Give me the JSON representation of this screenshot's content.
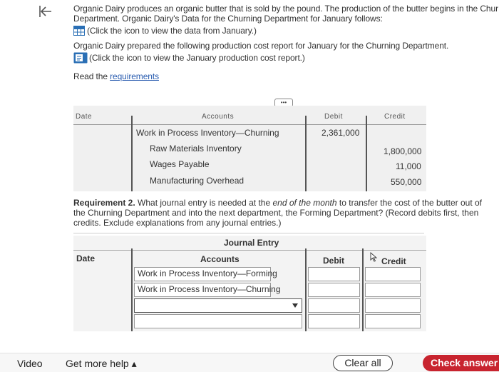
{
  "intro": {
    "line1": "Organic Dairy produces an organic butter that is sold by the pound. The production of the butter begins in the Chur",
    "line2": "Department. Organic Dairy's Data for the Churning Department for January follows:",
    "data_link": "(Click the icon to view the data from January.)",
    "line4": "Organic Dairy prepared the following production cost report for January for the Churning Department.",
    "report_link": "(Click the icon to view the January production cost report.)",
    "read_prefix": "Read the ",
    "requirements_link": "requirements"
  },
  "table1": {
    "headers": {
      "date": "Date",
      "accounts": "Accounts",
      "debit": "Debit",
      "credit": "Credit"
    },
    "more_button": "•••",
    "rows": [
      {
        "account": "Work in Process Inventory—Churning",
        "debit": "2,361,000",
        "credit": ""
      },
      {
        "account": "Raw Materials Inventory",
        "debit": "",
        "credit": "1,800,000"
      },
      {
        "account": "Wages Payable",
        "debit": "",
        "credit": "11,000"
      },
      {
        "account": "Manufacturing Overhead",
        "debit": "",
        "credit": "550,000"
      }
    ]
  },
  "requirement2": {
    "label": "Requirement 2.",
    "text_a": " What journal entry is needed at the ",
    "emph": "end of the month",
    "text_b": " to transfer the cost of the butter out of the Churning Department and into the next department, the Forming Department? (Record debits first, then credits. Exclude explanations from any journal entries.)"
  },
  "journal": {
    "title": "Journal Entry",
    "headers": {
      "date": "Date",
      "accounts": "Accounts",
      "debit": "Debit",
      "credit": "Credit"
    },
    "rows": [
      {
        "account": "Work in Process Inventory—Forming"
      },
      {
        "account": "Work in Process Inventory—Churning"
      },
      {
        "account": ""
      },
      {
        "account": ""
      }
    ]
  },
  "footer": {
    "video": "Video",
    "help": "Get more help ▴",
    "clear": "Clear all",
    "check": "Check answer"
  }
}
